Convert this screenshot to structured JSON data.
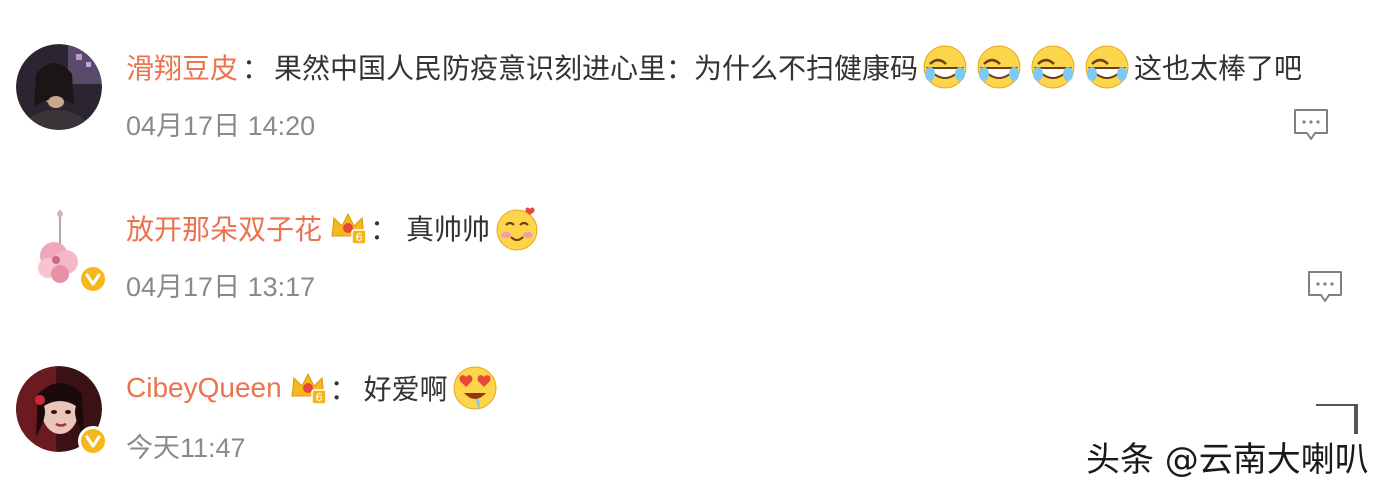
{
  "comments": [
    {
      "username": "滑翔豆皮",
      "separator": "：",
      "text_before_emoji": "果然中国人民防疫意识刻进心里：为什么不扫健康码",
      "emoji": "laugh-cry-emoji",
      "emoji_count": 4,
      "text_after_emoji": "这也太棒了吧",
      "timestamp": "04月17日 14:20",
      "verified": false,
      "member_crown": false
    },
    {
      "username": "放开那朵双子花",
      "separator": "：",
      "text": "真帅帅",
      "emoji": "blush-love-emoji",
      "timestamp": "04月17日 13:17",
      "verified": true,
      "member_crown": true,
      "crown_level": "6"
    },
    {
      "username": "CibeyQueen",
      "separator": "：",
      "text": "好爱啊",
      "emoji": "heart-eyes-drool-emoji",
      "timestamp": "今天11:47",
      "verified": true,
      "member_crown": true,
      "crown_level": "6"
    }
  ],
  "watermark": "头条 @云南大喇叭",
  "colors": {
    "username": "#eb7350",
    "text": "#333333",
    "timestamp": "#8a8a8a",
    "verified_badge": "#f5b81c"
  }
}
